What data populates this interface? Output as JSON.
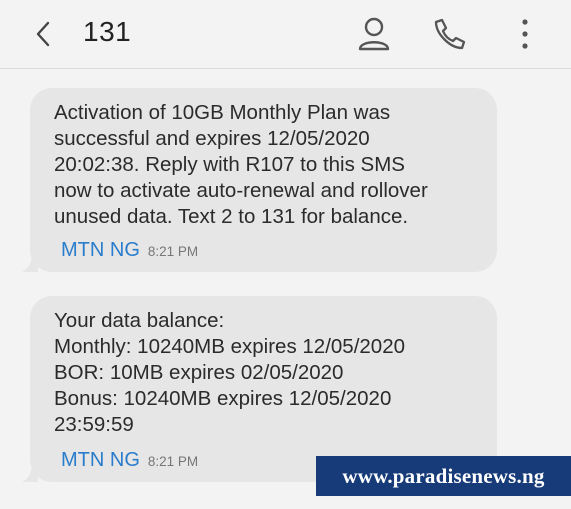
{
  "header": {
    "title": "131",
    "back_icon": "chevron-left-icon",
    "contact_icon": "person-icon",
    "call_icon": "phone-icon",
    "more_icon": "vertical-dots-icon"
  },
  "messages": [
    {
      "text": "Activation of 10GB Monthly Plan was\nsuccessful and expires 12/05/2020\n20:02:38. Reply with R107 to this SMS\nnow to activate auto-renewal and rollover\nunused data. Text 2 to 131 for balance.",
      "sender": "MTN NG",
      "time": "8:21 PM"
    },
    {
      "text": "Your data balance:\nMonthly: 10240MB expires 12/05/2020\nBOR: 10MB expires 02/05/2020\nBonus: 10240MB expires 12/05/2020\n23:59:59",
      "sender": "MTN NG",
      "time": "8:21 PM"
    }
  ],
  "watermark": "www.paradisenews.ng",
  "colors": {
    "background": "#f3f3f3",
    "bubble": "#e6e6e6",
    "sender": "#2a7ccc",
    "watermark_bg": "#163b78"
  }
}
